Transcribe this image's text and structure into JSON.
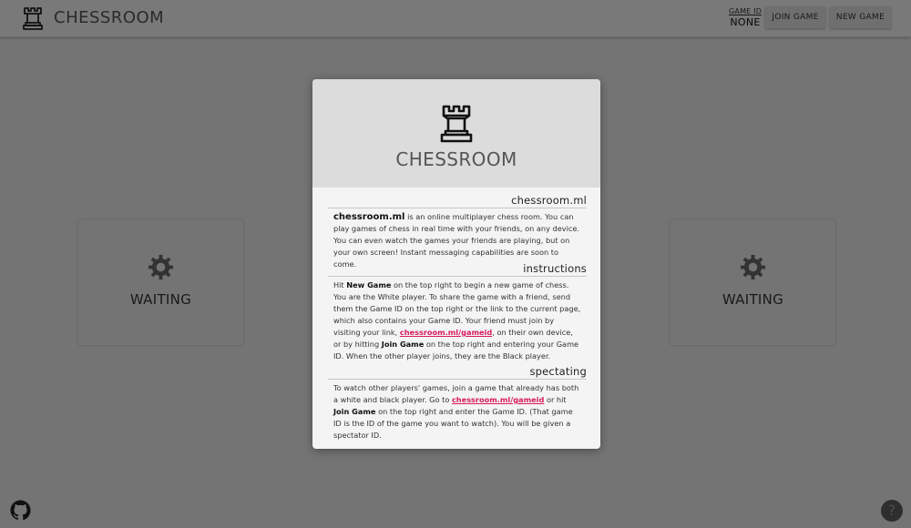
{
  "header": {
    "brand": "CHESSROOM",
    "game_id_label": "GAME ID",
    "game_id_value": "NONE",
    "join_label": "JOIN GAME",
    "new_label": "NEW GAME"
  },
  "panels": {
    "left_status": "WAITING",
    "right_status": "WAITING"
  },
  "modal": {
    "title": "CHESSROOM",
    "about": {
      "heading": "chessroom.ml",
      "site_name": "chessroom.ml",
      "text": " is an online multiplayer chess room. You can play games of chess in real time with your friends, on any device. You can even watch the games your friends are playing, but on your own screen! Instant messaging capabilities are soon to come."
    },
    "instructions": {
      "heading": "instructions",
      "t1": "Hit ",
      "b1": "New Game",
      "t2": " on the top right to begin a new game of chess. You are the White player. To share the game with a friend, send them the Game ID on the top right or the link to the current page, which also contains your Game ID. Your friend must join by visiting your link, ",
      "link": "chessroom.ml/gameid",
      "t3": ", on their own device, or by hitting ",
      "b2": "Join Game",
      "t4": " on the top right and entering your Game ID. When the other player joins, they are the Black player."
    },
    "spectating": {
      "heading": "spectating",
      "t1": "To watch other players' games, join a game that already has both a white and black player. Go to ",
      "link": "chessroom.ml/gameid",
      "t2": " or hit ",
      "b1": "Join Game",
      "t3": " on the top right and enter the Game ID. (That game ID is the ID of the game you want to watch). You will be given a spectator ID."
    }
  },
  "footer": {
    "help_label": "?"
  },
  "icons": {
    "logo": "rook-icon",
    "loading": "gear-icon",
    "github": "github-icon",
    "help": "help-icon"
  },
  "colors": {
    "link": "#d81b60",
    "overlay": "rgba(0,0,0,0.5)",
    "modal_header": "#dcdcdc"
  }
}
